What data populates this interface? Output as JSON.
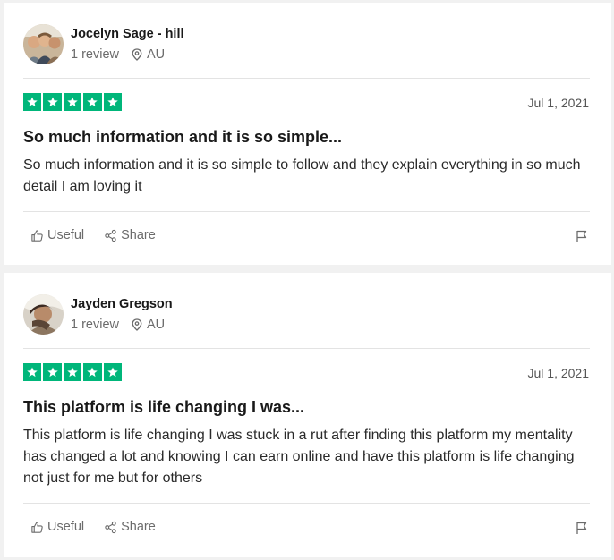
{
  "reviews": [
    {
      "reviewer_name": "Jocelyn Sage - hill",
      "review_count": "1 review",
      "location": "AU",
      "rating": 5,
      "date": "Jul 1, 2021",
      "title": "So much information and it is so simple...",
      "body": "So much information and it is so simple to follow and they explain everything in so much detail I am loving it",
      "useful_label": "Useful",
      "share_label": "Share"
    },
    {
      "reviewer_name": "Jayden Gregson",
      "review_count": "1 review",
      "location": "AU",
      "rating": 5,
      "date": "Jul 1, 2021",
      "title": "This platform is life changing I was...",
      "body": "This platform is life changing I was stuck in a rut after finding this platform my mentality has changed a lot and knowing I can earn online and have this platform is life changing not just for me but for others",
      "useful_label": "Useful",
      "share_label": "Share"
    }
  ],
  "colors": {
    "star_green": "#00b67a",
    "page_background": "#f1f1f1",
    "card_background": "#ffffff"
  },
  "icons": [
    "star-icon",
    "location-pin-icon",
    "thumbs-up-icon",
    "share-icon",
    "flag-icon"
  ]
}
